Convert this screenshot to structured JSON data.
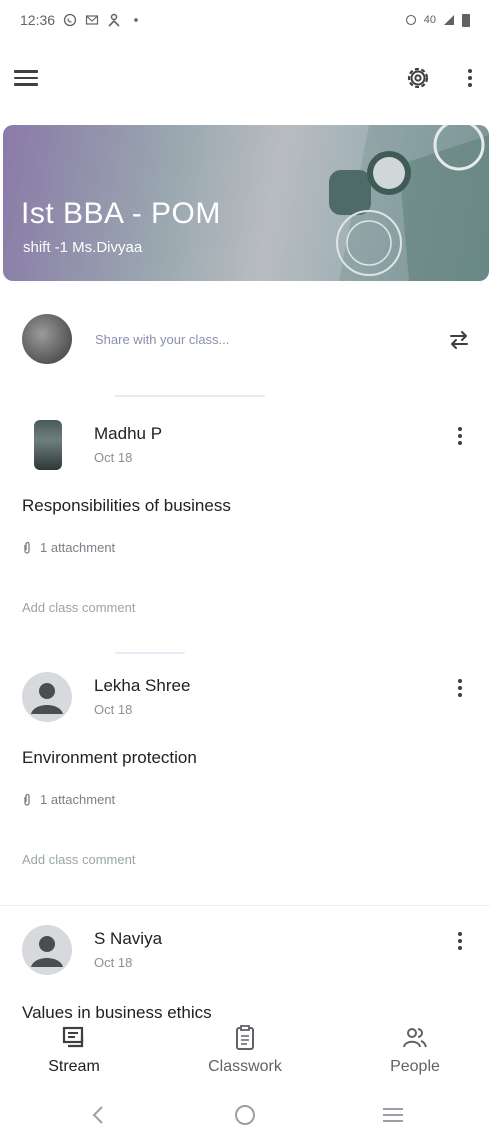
{
  "status": {
    "time": "12:36",
    "right_text": "40"
  },
  "course": {
    "title": "Ist BBA  - POM",
    "subtitle": "shift -1 Ms.Divyaa"
  },
  "share": {
    "placeholder": "Share with your class..."
  },
  "posts": [
    {
      "author": "Madhu P",
      "date": "Oct 18",
      "text": "Responsibilities of business",
      "attachment": "1 attachment",
      "comment": "Add class comment"
    },
    {
      "author": "Lekha Shree",
      "date": "Oct 18",
      "text": "Environment protection",
      "attachment": "1 attachment",
      "comment": "Add class comment"
    },
    {
      "author": "S Naviya",
      "date": "Oct 18",
      "text": "Values in business ethics"
    }
  ],
  "nav": {
    "stream": "Stream",
    "classwork": "Classwork",
    "people": "People"
  },
  "icons": {
    "menu": "menu-icon",
    "settings": "gear-icon",
    "more": "more-vert-icon",
    "repost": "repost-icon",
    "attachment": "paperclip-icon",
    "back": "back-icon",
    "home": "home-circle-icon",
    "recents": "recents-icon"
  },
  "colors": {
    "accent": "#1a73e8",
    "text": "#202124",
    "muted": "#5f6368"
  }
}
